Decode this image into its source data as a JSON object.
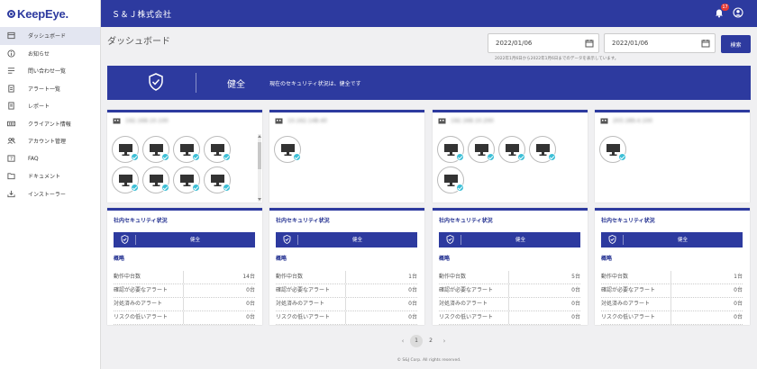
{
  "app": {
    "logo_text": "KeepEye."
  },
  "sidebar": {
    "items": [
      {
        "label": "ダッシュボード",
        "icon": "dashboard-icon",
        "active": true
      },
      {
        "label": "お知らせ",
        "icon": "info-icon"
      },
      {
        "label": "問い合わせ一覧",
        "icon": "inquiry-list-icon"
      },
      {
        "label": "アラート一覧",
        "icon": "alert-list-icon"
      },
      {
        "label": "レポート",
        "icon": "report-icon"
      },
      {
        "label": "クライアント情報",
        "icon": "client-icon"
      },
      {
        "label": "アカウント管理",
        "icon": "account-icon"
      },
      {
        "label": "FAQ",
        "icon": "faq-icon"
      },
      {
        "label": "ドキュメント",
        "icon": "document-icon"
      },
      {
        "label": "インストーラー",
        "icon": "installer-icon"
      }
    ]
  },
  "header": {
    "company": "Ｓ＆Ｊ株式会社",
    "notification_count": "17"
  },
  "main": {
    "page_title": "ダッシュボード",
    "date_from": "2022/01/06",
    "date_to": "2022/01/06",
    "search_label": "検索",
    "date_note": "2022年1月6日から2022年1月6日までのデータを表示しています。",
    "banner": {
      "status": "健全",
      "message": "現在のセキュリティ状況は、健全です"
    },
    "groups": [
      {
        "name": "192.168.10.100",
        "device_count": 14
      },
      {
        "name": "10.162.148.40",
        "device_count": 1
      },
      {
        "name": "192.168.10.200",
        "device_count": 5
      },
      {
        "name": "203.189.4.100",
        "device_count": 1
      }
    ],
    "security": [
      {
        "title": "社内セキュリティ状況",
        "status": "健全",
        "subtitle": "概略",
        "rows": [
          {
            "label": "動作中台数",
            "value": "14台"
          },
          {
            "label": "確認が必要なアラート",
            "value": "0台"
          },
          {
            "label": "対処済みのアラート",
            "value": "0台"
          },
          {
            "label": "リスクの低いアラート",
            "value": "0台"
          }
        ]
      },
      {
        "title": "社内セキュリティ状況",
        "status": "健全",
        "subtitle": "概略",
        "rows": [
          {
            "label": "動作中台数",
            "value": "1台"
          },
          {
            "label": "確認が必要なアラート",
            "value": "0台"
          },
          {
            "label": "対処済みのアラート",
            "value": "0台"
          },
          {
            "label": "リスクの低いアラート",
            "value": "0台"
          }
        ]
      },
      {
        "title": "社内セキュリティ状況",
        "status": "健全",
        "subtitle": "概略",
        "rows": [
          {
            "label": "動作中台数",
            "value": "5台"
          },
          {
            "label": "確認が必要なアラート",
            "value": "0台"
          },
          {
            "label": "対処済みのアラート",
            "value": "0台"
          },
          {
            "label": "リスクの低いアラート",
            "value": "0台"
          }
        ]
      },
      {
        "title": "社内セキュリティ状況",
        "status": "健全",
        "subtitle": "概略",
        "rows": [
          {
            "label": "動作中台数",
            "value": "1台"
          },
          {
            "label": "確認が必要なアラート",
            "value": "0台"
          },
          {
            "label": "対処済みのアラート",
            "value": "0台"
          },
          {
            "label": "リスクの低いアラート",
            "value": "0台"
          }
        ]
      }
    ],
    "pagination": {
      "prev": "‹",
      "pages": [
        "1",
        "2"
      ],
      "current": "1",
      "next": "›"
    },
    "footer": "© S&J Corp. All rights reserved."
  },
  "colors": {
    "brand": "#2d3a9f",
    "check": "#3dbfd6",
    "badge": "#e53935"
  }
}
